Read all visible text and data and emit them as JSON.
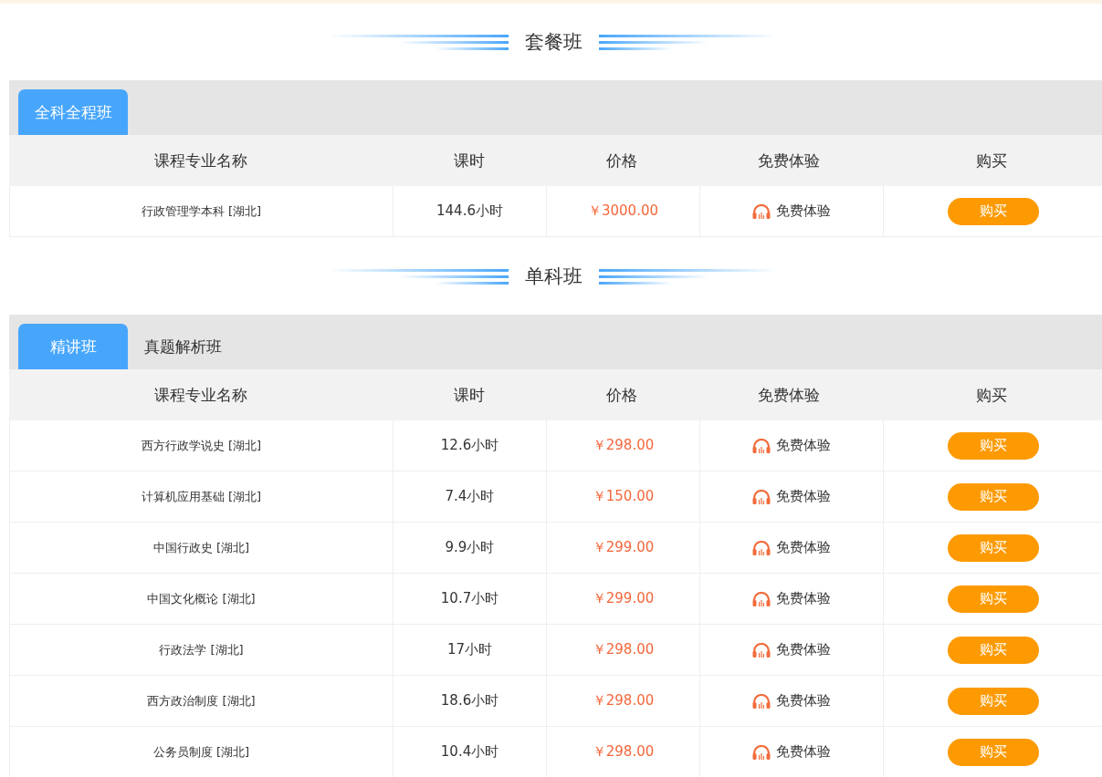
{
  "sections": [
    {
      "title": "套餐班",
      "tabs": [
        {
          "label": "全科全程班",
          "selected": true
        }
      ],
      "columns": [
        "课程专业名称",
        "课时",
        "价格",
        "免费体验",
        "购买"
      ],
      "rows": [
        {
          "name": "行政管理学本科 [湖北]",
          "hours": "144.6小时",
          "price": "￥3000.00",
          "trial": "免费体验",
          "buy": "购买"
        }
      ]
    },
    {
      "title": "单科班",
      "tabs": [
        {
          "label": "精讲班",
          "selected": true
        },
        {
          "label": "真题解析班",
          "selected": false
        }
      ],
      "columns": [
        "课程专业名称",
        "课时",
        "价格",
        "免费体验",
        "购买"
      ],
      "rows": [
        {
          "name": "西方行政学说史 [湖北]",
          "hours": "12.6小时",
          "price": "￥298.00",
          "trial": "免费体验",
          "buy": "购买"
        },
        {
          "name": "计算机应用基础 [湖北]",
          "hours": "7.4小时",
          "price": "￥150.00",
          "trial": "免费体验",
          "buy": "购买"
        },
        {
          "name": "中国行政史 [湖北]",
          "hours": "9.9小时",
          "price": "￥299.00",
          "trial": "免费体验",
          "buy": "购买"
        },
        {
          "name": "中国文化概论 [湖北]",
          "hours": "10.7小时",
          "price": "￥299.00",
          "trial": "免费体验",
          "buy": "购买"
        },
        {
          "name": "行政法学 [湖北]",
          "hours": "17小时",
          "price": "￥298.00",
          "trial": "免费体验",
          "buy": "购买"
        },
        {
          "name": "西方政治制度 [湖北]",
          "hours": "18.6小时",
          "price": "￥298.00",
          "trial": "免费体验",
          "buy": "购买"
        },
        {
          "name": "公务员制度 [湖北]",
          "hours": "10.4小时",
          "price": "￥298.00",
          "trial": "免费体验",
          "buy": "购买"
        }
      ]
    }
  ]
}
